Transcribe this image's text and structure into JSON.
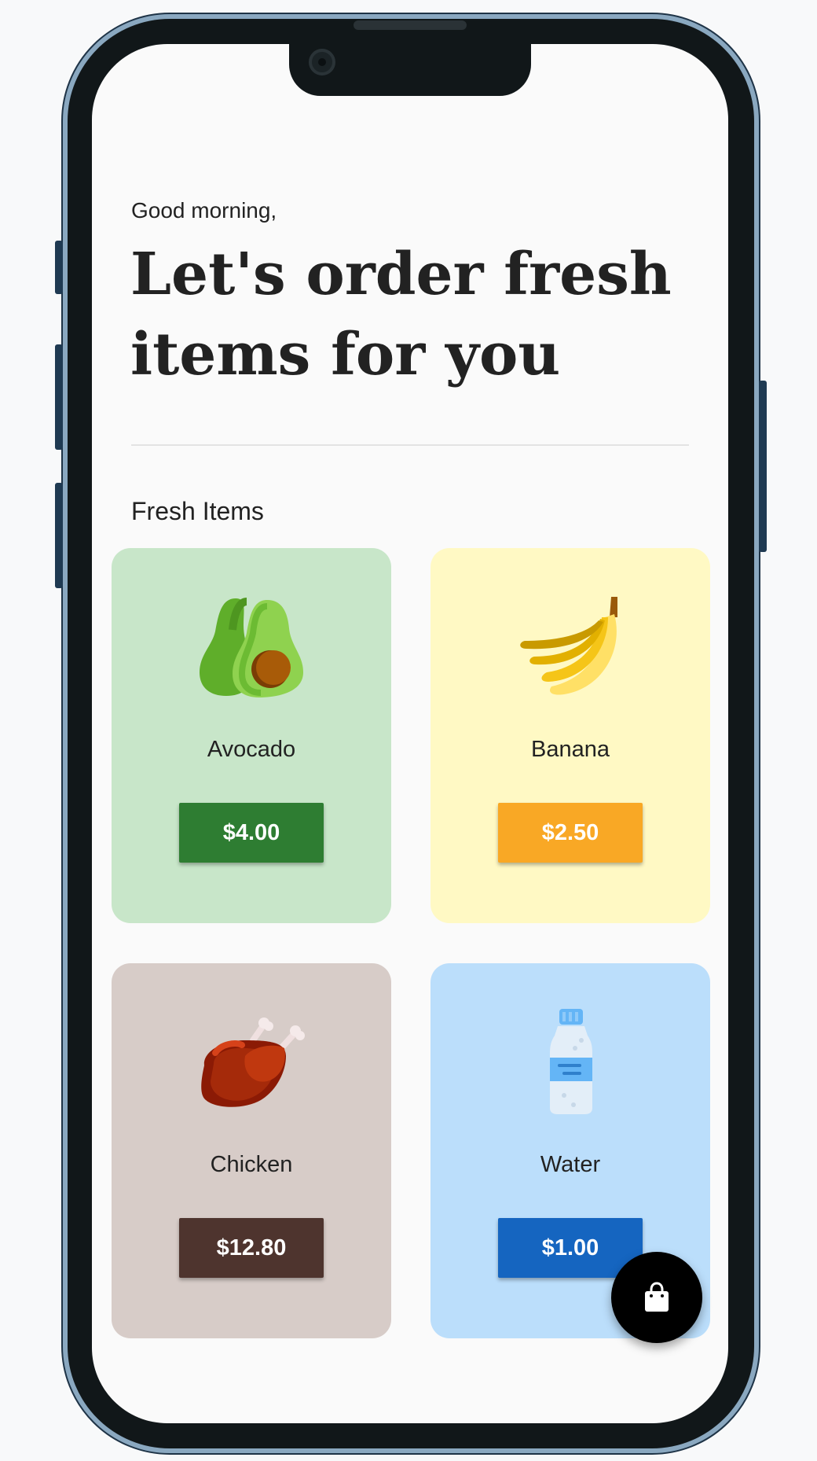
{
  "header": {
    "greeting": "Good morning,",
    "headline": "Let's order fresh items for you"
  },
  "section": {
    "title": "Fresh Items"
  },
  "items": [
    {
      "name": "Avocado",
      "price": "$4.00",
      "icon": "avocado-icon",
      "card_color": "#c8e6c9",
      "button_color": "#2e7d32"
    },
    {
      "name": "Banana",
      "price": "$2.50",
      "icon": "banana-icon",
      "card_color": "#fff9c4",
      "button_color": "#f9a825"
    },
    {
      "name": "Chicken",
      "price": "$12.80",
      "icon": "chicken-icon",
      "card_color": "#d7ccc8",
      "button_color": "#4e342e"
    },
    {
      "name": "Water",
      "price": "$1.00",
      "icon": "water-bottle-icon",
      "card_color": "#bbdefb",
      "button_color": "#1565c0"
    }
  ],
  "fab": {
    "icon": "shopping-bag-icon"
  }
}
